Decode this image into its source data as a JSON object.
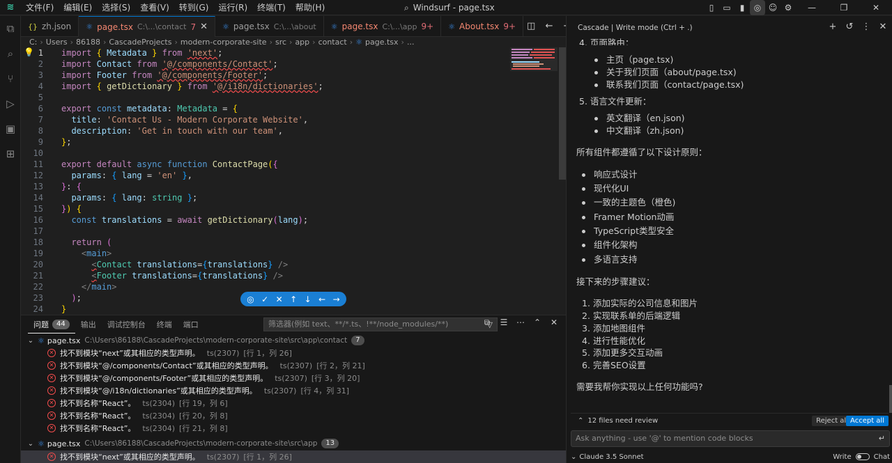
{
  "titlebar": {
    "app_icon": "windsurf-logo",
    "menu": [
      "文件(F)",
      "编辑(E)",
      "选择(S)",
      "查看(V)",
      "转到(G)",
      "运行(R)",
      "终端(T)",
      "帮助(H)"
    ],
    "title": "Windsurf - page.tsx"
  },
  "tabs": [
    {
      "label": "zh.json",
      "path": "",
      "badge": "",
      "icon": "json-icon",
      "active": false
    },
    {
      "label": "page.tsx",
      "path": "C:\\...\\contact",
      "badge": "7",
      "icon": "react-icon",
      "active": true
    },
    {
      "label": "page.tsx",
      "path": "C:\\...\\about",
      "badge": "",
      "icon": "react-icon",
      "active": false
    },
    {
      "label": "page.tsx",
      "path": "C:\\...\\app",
      "badge": "9+",
      "icon": "react-icon",
      "active": false
    },
    {
      "label": "About.tsx",
      "path": "",
      "badge": "9+",
      "icon": "react-icon",
      "active": false
    }
  ],
  "breadcrumb": [
    "C:",
    "Users",
    "86188",
    "CascadeProjects",
    "modern-corporate-site",
    "src",
    "app",
    "contact",
    "page.tsx",
    "..."
  ],
  "editor": {
    "line_numbers": [
      "1",
      "2",
      "3",
      "4",
      "5",
      "6",
      "7",
      "8",
      "9",
      "10",
      "11",
      "12",
      "13",
      "14",
      "15",
      "16",
      "17",
      "18",
      "19",
      "20",
      "21",
      "22",
      "23",
      "24"
    ]
  },
  "panel": {
    "tabs": [
      {
        "label": "问题",
        "count": "44"
      },
      {
        "label": "输出"
      },
      {
        "label": "调试控制台"
      },
      {
        "label": "终端"
      },
      {
        "label": "端口"
      }
    ],
    "filter_placeholder": "筛选器(例如 text、**/*.ts、!**/node_modules/**)",
    "groups": [
      {
        "file": "page.tsx",
        "path": "C:\\Users\\86188\\CascadeProjects\\modern-corporate-site\\src\\app\\contact",
        "count": "7",
        "items": [
          {
            "msg": "找不到模块“next”或其相应的类型声明。",
            "code": "ts(2307)",
            "pos": "[行 1，列 26]"
          },
          {
            "msg": "找不到模块“@/components/Contact”或其相应的类型声明。",
            "code": "ts(2307)",
            "pos": "[行 2，列 21]"
          },
          {
            "msg": "找不到模块“@/components/Footer”或其相应的类型声明。",
            "code": "ts(2307)",
            "pos": "[行 3，列 20]"
          },
          {
            "msg": "找不到模块“@/i18n/dictionaries”或其相应的类型声明。",
            "code": "ts(2307)",
            "pos": "[行 4，列 31]"
          },
          {
            "msg": "找不到名称“React”。",
            "code": "ts(2304)",
            "pos": "[行 19，列 6]"
          },
          {
            "msg": "找不到名称“React”。",
            "code": "ts(2304)",
            "pos": "[行 20，列 8]"
          },
          {
            "msg": "找不到名称“React”。",
            "code": "ts(2304)",
            "pos": "[行 21，列 8]"
          }
        ]
      },
      {
        "file": "page.tsx",
        "path": "C:\\Users\\86188\\CascadeProjects\\modern-corporate-site\\src\\app",
        "count": "13",
        "items": [
          {
            "msg": "找不到模块“next”或其相应的类型声明。",
            "code": "ts(2307)",
            "pos": "[行 1，列 26]"
          }
        ]
      }
    ]
  },
  "cascade": {
    "header": "Cascade | Write mode (Ctrl + .)",
    "route_heading": "4.  页面路由：",
    "routes": [
      "主页（page.tsx)",
      "关于我们页面（about/page.tsx)",
      "联系我们页面（contact/page.tsx)"
    ],
    "lang_heading": "5.  语言文件更新：",
    "langs": [
      "英文翻译（en.json)",
      "中文翻译（zh.json)"
    ],
    "principles_heading": "所有组件都遵循了以下设计原则：",
    "principles": [
      "响应式设计",
      "现代化UI",
      "一致的主题色（橙色)",
      "Framer Motion动画",
      "TypeScript类型安全",
      "组件化架构",
      "多语言支持"
    ],
    "next_heading": "接下来的步骤建议：",
    "next_steps": [
      "添加实际的公司信息和图片",
      "实现联系单的后端逻辑",
      "添加地图组件",
      "进行性能优化",
      "添加更多交互动画",
      "完善SEO设置"
    ],
    "question": "需要我帮你实现以上任何功能吗?",
    "files_review": "12 files need review",
    "reject_label": "Reject all",
    "accept_label": "Accept all",
    "ask_placeholder": "Ask anything - use '@' to mention code blocks",
    "model": "Claude 3.5 Sonnet",
    "write_label": "Write",
    "chat_label": "Chat"
  }
}
